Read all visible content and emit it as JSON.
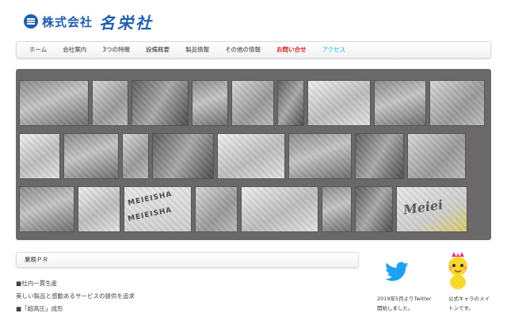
{
  "logo": {
    "corp_label": "株式会社",
    "name": "名栄社"
  },
  "nav": {
    "items": [
      {
        "label": "ホーム"
      },
      {
        "label": "会社案内"
      },
      {
        "label": "3つの特徴"
      },
      {
        "label": "設備概要"
      },
      {
        "label": "製品情報"
      },
      {
        "label": "その他の情報"
      },
      {
        "label": "お問い合せ"
      },
      {
        "label": "アクセス"
      }
    ],
    "colors": {
      "inquiry": "#d42020",
      "access": "#19b5d6"
    }
  },
  "gallery": {
    "text_photos": {
      "brand_1": "MEIEISHA",
      "brand_2": "MEIEISHA",
      "script": "Meiei"
    }
  },
  "pr": {
    "heading": "業務ＰＲ",
    "lines": [
      "■社内一貫生産",
      "美しい製品と感動あるサービスの提供を追求",
      "■「超高圧」成形"
    ]
  },
  "twitter": {
    "caption_line1": "2019年5月よりTwitter",
    "caption_line2": "開始しました。",
    "icon": "twitter-bird-icon",
    "color": "#1da1f2"
  },
  "mascot": {
    "caption_line1": "公式キャラのメイ",
    "caption_line2": "トンです。"
  }
}
